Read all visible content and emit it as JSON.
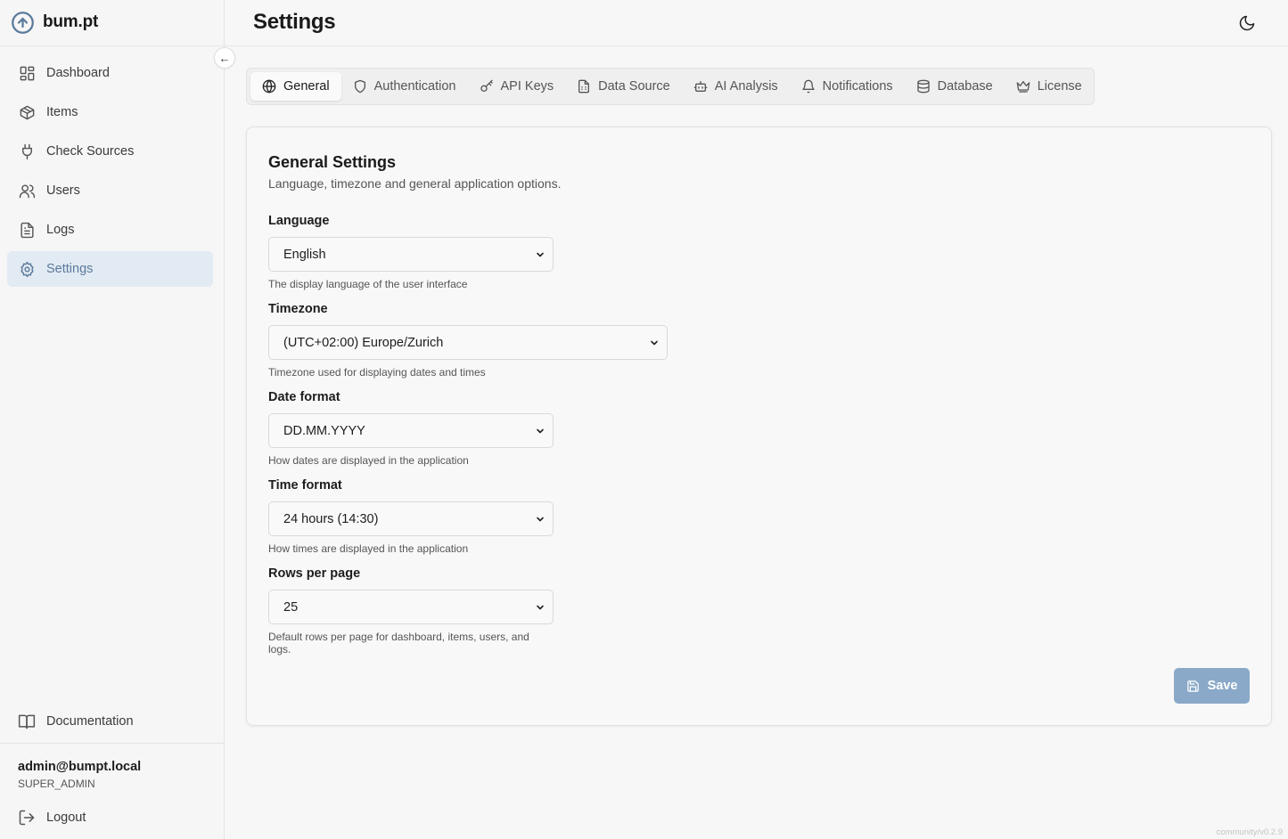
{
  "app": {
    "name": "bum.pt"
  },
  "header": {
    "title": "Settings"
  },
  "sidebar": {
    "items": [
      {
        "label": "Dashboard",
        "icon": "dashboard-icon"
      },
      {
        "label": "Items",
        "icon": "box-icon"
      },
      {
        "label": "Check Sources",
        "icon": "plug-icon"
      },
      {
        "label": "Users",
        "icon": "users-icon"
      },
      {
        "label": "Logs",
        "icon": "file-text-icon"
      },
      {
        "label": "Settings",
        "icon": "gear-icon",
        "active": true
      }
    ],
    "documentation_label": "Documentation",
    "user": {
      "email": "admin@bumpt.local",
      "role": "SUPER_ADMIN"
    },
    "logout_label": "Logout"
  },
  "tabs": [
    {
      "label": "General",
      "icon": "globe-icon",
      "active": true
    },
    {
      "label": "Authentication",
      "icon": "shield-icon"
    },
    {
      "label": "API Keys",
      "icon": "key-icon"
    },
    {
      "label": "Data Source",
      "icon": "file-sheet-icon"
    },
    {
      "label": "AI Analysis",
      "icon": "bot-icon"
    },
    {
      "label": "Notifications",
      "icon": "bell-icon"
    },
    {
      "label": "Database",
      "icon": "database-icon"
    },
    {
      "label": "License",
      "icon": "crown-icon"
    }
  ],
  "card": {
    "title": "General Settings",
    "subtitle": "Language, timezone and general application options.",
    "fields": {
      "language": {
        "label": "Language",
        "value": "English",
        "hint": "The display language of the user interface"
      },
      "timezone": {
        "label": "Timezone",
        "value": "(UTC+02:00) Europe/Zurich",
        "hint": "Timezone used for displaying dates and times"
      },
      "date_format": {
        "label": "Date format",
        "value": "DD.MM.YYYY",
        "hint": "How dates are displayed in the application"
      },
      "time_format": {
        "label": "Time format",
        "value": "24 hours (14:30)",
        "hint": "How times are displayed in the application"
      },
      "rows_per_page": {
        "label": "Rows per page",
        "value": "25",
        "hint": "Default rows per page for dashboard, items, users, and logs."
      }
    },
    "save_label": "Save"
  },
  "version": "community/v0.2.9",
  "colors": {
    "accent": "#5b7a9c",
    "active_bg": "#e2eaf3",
    "save_button": "#8aa9c8"
  }
}
